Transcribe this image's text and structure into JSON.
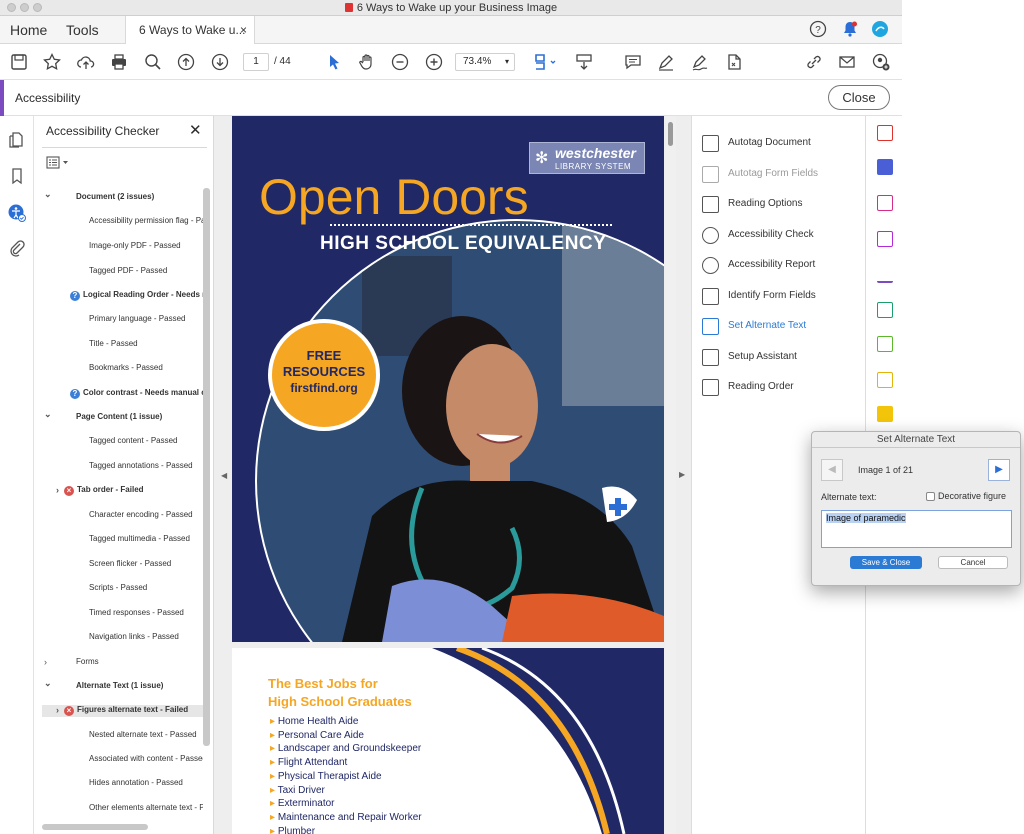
{
  "window": {
    "title": "6 Ways to Wake up your Business Image"
  },
  "tabs": {
    "home": "Home",
    "tools": "Tools",
    "document": "6 Ways to Wake u...",
    "close": "×"
  },
  "toolbar": {
    "page_current": "1",
    "page_total": "/ 44",
    "zoom": "73.4%"
  },
  "tool_header": {
    "name": "Accessibility",
    "close_label": "Close"
  },
  "checker": {
    "title": "Accessibility Checker",
    "rows": [
      {
        "text": "Document (2 issues)",
        "bold": true,
        "level": 0,
        "chev": "⌄",
        "icon": ""
      },
      {
        "text": "Accessibility permission flag - Passed",
        "bold": false,
        "level": 2,
        "chev": "",
        "icon": ""
      },
      {
        "text": "Image-only PDF - Passed",
        "bold": false,
        "level": 2,
        "chev": "",
        "icon": ""
      },
      {
        "text": "Tagged PDF - Passed",
        "bold": false,
        "level": 2,
        "chev": "",
        "icon": ""
      },
      {
        "text": "Logical Reading Order - Needs manual check",
        "bold": true,
        "level": 1,
        "chev": "",
        "icon": "q"
      },
      {
        "text": "Primary language - Passed",
        "bold": false,
        "level": 2,
        "chev": "",
        "icon": ""
      },
      {
        "text": "Title - Passed",
        "bold": false,
        "level": 2,
        "chev": "",
        "icon": ""
      },
      {
        "text": "Bookmarks - Passed",
        "bold": false,
        "level": 2,
        "chev": "",
        "icon": ""
      },
      {
        "text": "Color contrast - Needs manual check",
        "bold": true,
        "level": 1,
        "chev": "",
        "icon": "q"
      },
      {
        "text": "Page Content (1 issue)",
        "bold": true,
        "level": 0,
        "chev": "⌄",
        "icon": ""
      },
      {
        "text": "Tagged content - Passed",
        "bold": false,
        "level": 2,
        "chev": "",
        "icon": ""
      },
      {
        "text": "Tagged annotations - Passed",
        "bold": false,
        "level": 2,
        "chev": "",
        "icon": ""
      },
      {
        "text": "Tab order - Failed",
        "bold": true,
        "level": 1,
        "chev": "›",
        "icon": "f"
      },
      {
        "text": "Character encoding - Passed",
        "bold": false,
        "level": 2,
        "chev": "",
        "icon": ""
      },
      {
        "text": "Tagged multimedia - Passed",
        "bold": false,
        "level": 2,
        "chev": "",
        "icon": ""
      },
      {
        "text": "Screen flicker - Passed",
        "bold": false,
        "level": 2,
        "chev": "",
        "icon": ""
      },
      {
        "text": "Scripts - Passed",
        "bold": false,
        "level": 2,
        "chev": "",
        "icon": ""
      },
      {
        "text": "Timed responses - Passed",
        "bold": false,
        "level": 2,
        "chev": "",
        "icon": ""
      },
      {
        "text": "Navigation links - Passed",
        "bold": false,
        "level": 2,
        "chev": "",
        "icon": ""
      },
      {
        "text": "Forms",
        "bold": false,
        "level": 0,
        "chev": "›",
        "icon": ""
      },
      {
        "text": "Alternate Text (1 issue)",
        "bold": true,
        "level": 0,
        "chev": "⌄",
        "icon": ""
      },
      {
        "text": "Figures alternate text - Failed",
        "bold": true,
        "level": 1,
        "chev": "›",
        "icon": "f",
        "selected": true
      },
      {
        "text": "Nested alternate text - Passed",
        "bold": false,
        "level": 2,
        "chev": "",
        "icon": ""
      },
      {
        "text": "Associated with content - Passed",
        "bold": false,
        "level": 2,
        "chev": "",
        "icon": ""
      },
      {
        "text": "Hides annotation - Passed",
        "bold": false,
        "level": 2,
        "chev": "",
        "icon": ""
      },
      {
        "text": "Other elements alternate text - Passed",
        "bold": false,
        "level": 2,
        "chev": "",
        "icon": ""
      }
    ]
  },
  "document": {
    "logo_line1": "westchester",
    "logo_line2": "LIBRARY SYSTEM",
    "headline": "Open Doors",
    "subheadline": "HIGH SCHOOL EQUIVALENCY",
    "badge_line1": "FREE",
    "badge_line2": "RESOURCES",
    "badge_line3": "firstfind.org",
    "jobs_title_line1": "The Best Jobs for",
    "jobs_title_line2": "High School Graduates",
    "jobs": [
      "Home Health Aide",
      "Personal Care Aide",
      "Landscaper and Groundskeeper",
      "Flight Attendant",
      "Physical Therapist Aide",
      "Taxi Driver",
      "Exterminator",
      "Maintenance and Repair Worker",
      "Plumber"
    ]
  },
  "tools": [
    {
      "label": "Autotag Document",
      "disabled": false,
      "active": false
    },
    {
      "label": "Autotag Form Fields",
      "disabled": true,
      "active": false
    },
    {
      "label": "Reading Options",
      "disabled": false,
      "active": false
    },
    {
      "label": "Accessibility Check",
      "disabled": false,
      "active": false
    },
    {
      "label": "Accessibility Report",
      "disabled": false,
      "active": false
    },
    {
      "label": "Identify Form Fields",
      "disabled": false,
      "active": false
    },
    {
      "label": "Set Alternate Text",
      "disabled": false,
      "active": true
    },
    {
      "label": "Setup Assistant",
      "disabled": false,
      "active": false
    },
    {
      "label": "Reading Order",
      "disabled": false,
      "active": false
    }
  ],
  "dialog": {
    "title": "Set Alternate Text",
    "counter": "Image 1 of 21",
    "alt_label": "Alternate text:",
    "decorative_label": "Decorative figure",
    "alt_value": "Image of paramedic",
    "save_label": "Save & Close",
    "cancel_label": "Cancel"
  },
  "colors": {
    "accent": "#7d4bc0",
    "navy": "#202866",
    "orange": "#f5a623",
    "link_blue": "#2b7bd4"
  }
}
